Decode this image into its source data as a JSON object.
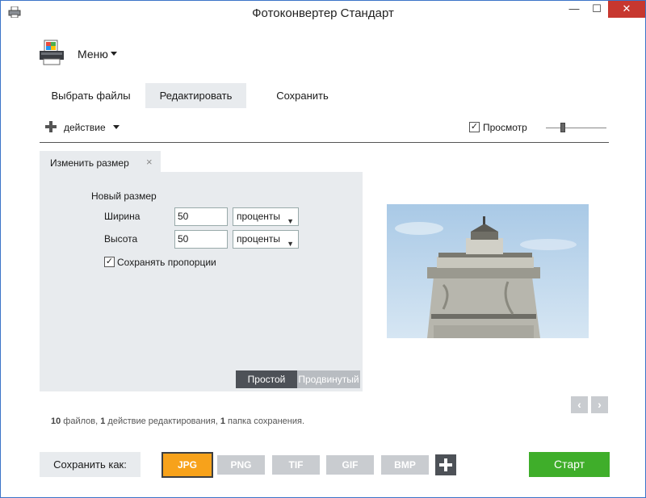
{
  "window": {
    "title": "Фотоконвертер Стандарт",
    "minimize_glyph": "—",
    "maximize_glyph": "☐",
    "close_glyph": "✕"
  },
  "menu": {
    "label": "Меню"
  },
  "tabs": [
    {
      "label": "Выбрать файлы"
    },
    {
      "label": "Редактировать",
      "active": true
    },
    {
      "label": "Сохранить"
    }
  ],
  "toolbar": {
    "action_label": "действие",
    "preview_label": "Просмотр",
    "preview_checked": true
  },
  "edit_panel": {
    "tab_label": "Изменить размер",
    "close_glyph": "×",
    "section_title": "Новый размер",
    "width_label": "Ширина",
    "width_value": "50",
    "width_unit": "проценты",
    "height_label": "Высота",
    "height_value": "50",
    "height_unit": "проценты",
    "keep_ratio_label": "Сохранять пропорции",
    "keep_ratio_checked": true,
    "mode_simple": "Простой",
    "mode_advanced": "Продвинутый"
  },
  "nav": {
    "prev": "‹",
    "next": "›"
  },
  "summary": {
    "files_count": "10",
    "files_text": " файлов, ",
    "actions_count": "1",
    "actions_text": " действие редактирования, ",
    "folders_count": "1",
    "folders_text": " папка сохранения."
  },
  "footer": {
    "save_as_label": "Сохранить как:",
    "formats": [
      "JPG",
      "PNG",
      "TIF",
      "GIF",
      "BMP"
    ],
    "active_format": "JPG",
    "start_label": "Старт"
  },
  "colors": {
    "accent_orange": "#f7a21b",
    "start_green": "#3fae2a",
    "panel_gray": "#e8ebee",
    "close_red": "#c7372f"
  }
}
